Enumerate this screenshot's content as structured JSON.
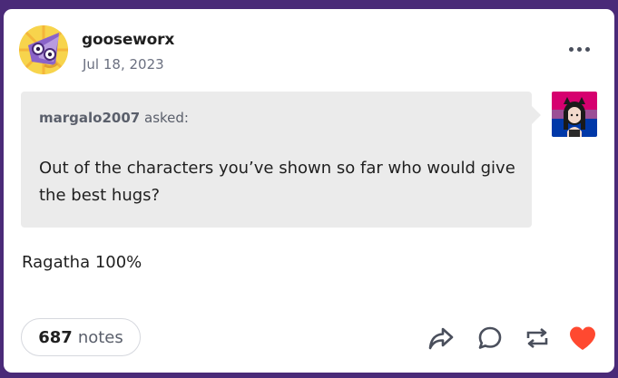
{
  "post": {
    "username": "gooseworx",
    "date": "Jul 18, 2023"
  },
  "ask": {
    "asker": "margalo2007",
    "asked_label": "asked:",
    "question": "Out of the characters you’ve shown so far who would give the best hugs?"
  },
  "answer": "Ragatha 100%",
  "footer": {
    "notes_count": "687",
    "notes_label": "notes"
  },
  "icons": {
    "more": "more-horizontal-icon",
    "share": "share-icon",
    "reply": "reply-icon",
    "reblog": "reblog-icon",
    "like": "heart-icon"
  },
  "colors": {
    "frame": "#4a2a78",
    "like": "#ff4930",
    "ask_background": "#ebebeb"
  }
}
